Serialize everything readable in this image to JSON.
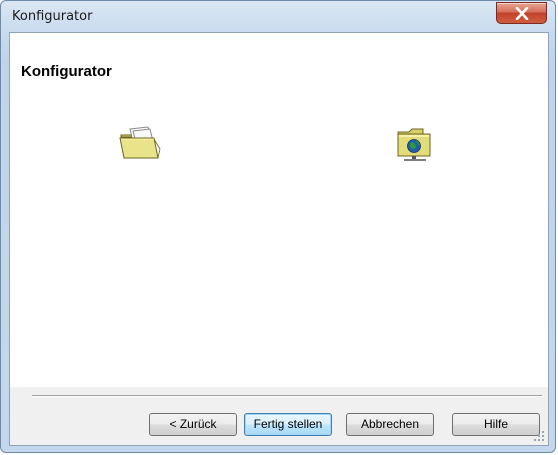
{
  "window": {
    "title": "Konfigurator",
    "close_icon": "close-x-icon",
    "colors": {
      "close_button": "#c1422a",
      "frame": "#c4d7ec"
    }
  },
  "page": {
    "heading": "Konfigurator",
    "icons": [
      "open-folder-icon",
      "network-folder-icon"
    ]
  },
  "buttons": {
    "back": "< Zurück",
    "finish": "Fertig stellen",
    "cancel": "Abbrechen",
    "help": "Hilfe"
  }
}
